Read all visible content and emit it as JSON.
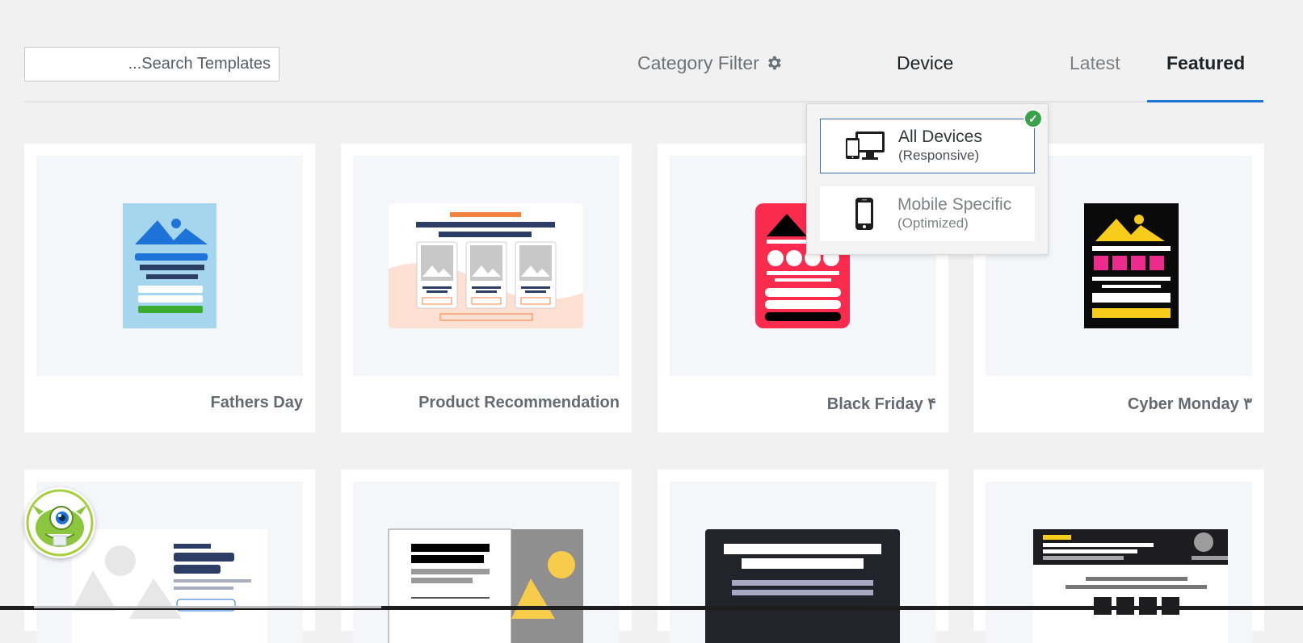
{
  "search": {
    "placeholder": "...Search Templates"
  },
  "nav": {
    "category_filter": "Category Filter",
    "device": "Device",
    "latest": "Latest",
    "featured": "Featured"
  },
  "device_menu": {
    "options": [
      {
        "label": "All Devices",
        "sub": "(Responsive)",
        "selected": true,
        "icon": "devices-icon"
      },
      {
        "label": "Mobile Specific",
        "sub": "(Optimized)",
        "selected": false,
        "icon": "mobile-phone-icon"
      }
    ],
    "check": "✓"
  },
  "templates": [
    {
      "title": "Fathers Day"
    },
    {
      "title": "Product Recommendation"
    },
    {
      "title": "Black Friday ۴"
    },
    {
      "title": "Cyber Monday ۳"
    }
  ],
  "colors": {
    "accent": "#1e73d8",
    "check": "#3aa34a"
  }
}
